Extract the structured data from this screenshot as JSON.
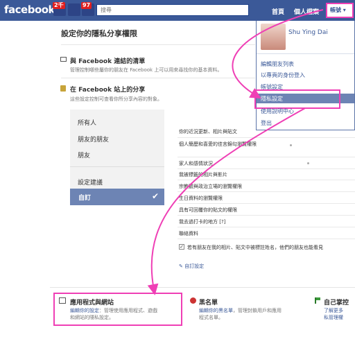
{
  "topbar": {
    "logo": "facebook",
    "friend_requests_badge": "2千",
    "notifications_badge": "97",
    "search_placeholder": "搜尋",
    "nav": {
      "home": "首頁",
      "profile": "個人檔案",
      "account": "帳號"
    }
  },
  "account_menu": {
    "user_name": "Shu Ying Dai",
    "items": [
      "編輯朋友列表",
      "以專頁的身份登入",
      "帳號設定",
      "隱私設定",
      "使用說明中心",
      "登出"
    ]
  },
  "page": {
    "title": "設定你的隱私分享權限",
    "connect": {
      "heading": "與 Facebook 連結的清單",
      "desc": "管理控制哪些屬你的朋友在 Facebook 上可以用來尋找你的基本資料。"
    },
    "sharing": {
      "heading": "在 Facebook 站上的分享",
      "desc": "這些設定控制可查看你所分享內容的對象。"
    },
    "audience_options": [
      "所有人",
      "朋友的朋友",
      "朋友",
      "設定建議",
      "自訂"
    ],
    "settings_rows": [
      "你的近況更新、相片與貼文",
      "個人簡歷和喜愛的佳言錦句瀏覽權限",
      "家人和感情狀況",
      "我被標籤的相片與影片",
      "宗教觀與政治立場的瀏覽權限",
      "生日資料的瀏覽權限",
      "具有可回覆你的貼文的權限",
      "我去過打卡的地方 [?]",
      "聯絡資料"
    ],
    "checkbox_label": "若有朋友在我的相片、貼文中被標註姓名，他們的朋友也能看見",
    "custom_settings_link": "自訂設定"
  },
  "bottom": {
    "apps": {
      "title": "應用程式與網站",
      "link": "編輯你的設定",
      "desc_line1": "：管理使用應用程式、遊戲",
      "desc_line2": "和網站的隱私設定。"
    },
    "block": {
      "title": "黑名單",
      "link": "編輯你的黑名單",
      "desc_line1": "，管理封鎖用戶和應用",
      "desc_line2": "程式名單。"
    },
    "control": {
      "title": "自己掌控",
      "link_line1": "了解更多",
      "link_line2": "私管理權"
    }
  },
  "colors": {
    "facebook_blue": "#3b5998",
    "highlight_pink": "#ef3fb5",
    "selected_row": "#6d84b4"
  }
}
